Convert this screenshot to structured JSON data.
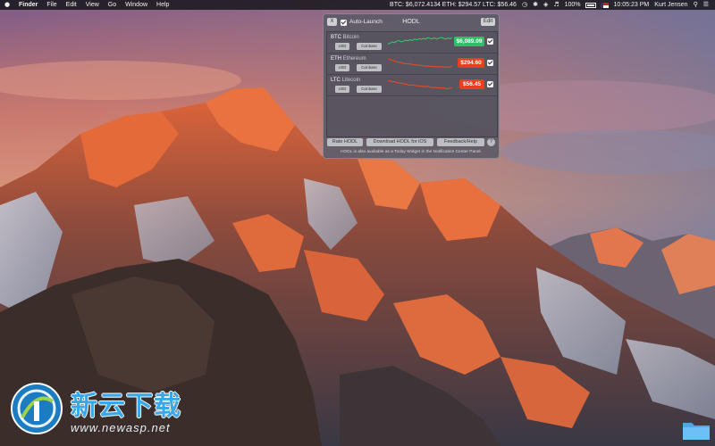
{
  "menubar": {
    "apple_icon": "apple-logo",
    "app_name": "Finder",
    "menus": [
      "File",
      "Edit",
      "View",
      "Go",
      "Window",
      "Help"
    ],
    "ticker": "BTC: $6,072.4134 ETH: $294.57 LTC: $56.46",
    "battery": "100%",
    "datetime": "10:05:23 PM",
    "user": "Kurt Jensen"
  },
  "panel": {
    "close_label": "X",
    "autolaunch_label": "Auto-Launch",
    "title": "HODL",
    "edit_label": "Edit",
    "coins": [
      {
        "symbol": "BTC",
        "name": "Bitcoin",
        "ex1": "USD",
        "ex2": "Coinbase",
        "price": "$6,089.09",
        "color": "#2fbf6a",
        "spark_color": "#2fd06e",
        "trend": [
          0.35,
          0.4,
          0.5,
          0.45,
          0.55,
          0.6,
          0.5,
          0.55,
          0.62,
          0.58,
          0.66,
          0.6,
          0.7,
          0.65,
          0.72,
          0.68,
          0.75,
          0.7,
          0.8,
          0.74,
          0.72,
          0.78,
          0.7,
          0.76,
          0.82,
          0.75,
          0.7,
          0.78,
          0.72,
          0.8
        ]
      },
      {
        "symbol": "ETH",
        "name": "Ethereum",
        "ex1": "USD",
        "ex2": "Coinbase",
        "price": "$294.60",
        "color": "#e8401f",
        "spark_color": "#f04a26",
        "trend": [
          0.8,
          0.75,
          0.72,
          0.66,
          0.6,
          0.58,
          0.55,
          0.5,
          0.48,
          0.45,
          0.46,
          0.42,
          0.4,
          0.38,
          0.36,
          0.37,
          0.33,
          0.3,
          0.32,
          0.28,
          0.3,
          0.26,
          0.28,
          0.25,
          0.27,
          0.24,
          0.26,
          0.22,
          0.25,
          0.3
        ]
      },
      {
        "symbol": "LTC",
        "name": "Litecoin",
        "ex1": "USD",
        "ex2": "Coinbase",
        "price": "$56.45",
        "color": "#e8401f",
        "spark_color": "#f04a26",
        "trend": [
          0.75,
          0.78,
          0.7,
          0.72,
          0.65,
          0.62,
          0.6,
          0.55,
          0.57,
          0.5,
          0.48,
          0.5,
          0.45,
          0.42,
          0.44,
          0.4,
          0.38,
          0.36,
          0.4,
          0.33,
          0.3,
          0.32,
          0.28,
          0.3,
          0.26,
          0.28,
          0.24,
          0.22,
          0.25,
          0.3
        ]
      }
    ],
    "buttons": {
      "rate": "Rate HODL",
      "download": "Download HODL for iOS",
      "feedback": "Feedback/Help",
      "help": "?"
    },
    "note": "HODL is also available as a Today Widget in the Notification Center Panel."
  },
  "watermark": {
    "cn": "新云下载",
    "url": "www.newasp.net"
  }
}
